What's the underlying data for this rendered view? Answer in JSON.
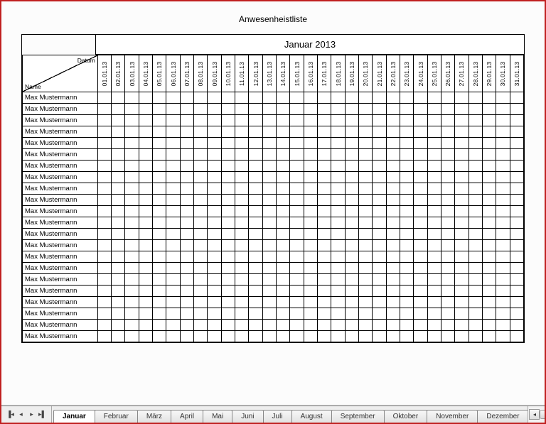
{
  "title": "Anwesenheistliste",
  "month_header": "Januar 2013",
  "corner": {
    "top": "Datum",
    "bottom": "Name"
  },
  "dates": [
    "01.01.13",
    "02.01.13",
    "03.01.13",
    "04.01.13",
    "05.01.13",
    "06.01.13",
    "07.01.13",
    "08.01.13",
    "09.01.13",
    "10.01.13",
    "11.01.13",
    "12.01.13",
    "13.01.13",
    "14.01.13",
    "15.01.13",
    "16.01.13",
    "17.01.13",
    "18.01.13",
    "19.01.13",
    "20.01.13",
    "21.01.13",
    "22.01.13",
    "23.01.13",
    "24.01.13",
    "25.01.13",
    "26.01.13",
    "27.01.13",
    "28.01.13",
    "29.01.13",
    "30.01.13",
    "31.01.13"
  ],
  "names": [
    "Max Mustermann",
    "Max Mustermann",
    "Max Mustermann",
    "Max Mustermann",
    "Max Mustermann",
    "Max Mustermann",
    "Max Mustermann",
    "Max Mustermann",
    "Max Mustermann",
    "Max Mustermann",
    "Max Mustermann",
    "Max Mustermann",
    "Max Mustermann",
    "Max Mustermann",
    "Max Mustermann",
    "Max Mustermann",
    "Max Mustermann",
    "Max Mustermann",
    "Max Mustermann",
    "Max Mustermann",
    "Max Mustermann",
    "Max Mustermann"
  ],
  "tabs": [
    "Januar",
    "Februar",
    "März",
    "April",
    "Mai",
    "Juni",
    "Juli",
    "August",
    "September",
    "Oktober",
    "November",
    "Dezember"
  ],
  "active_tab_index": 0,
  "nav": {
    "first": "▐◂",
    "prev": "◂",
    "next": "▸",
    "last": "▸▌"
  }
}
